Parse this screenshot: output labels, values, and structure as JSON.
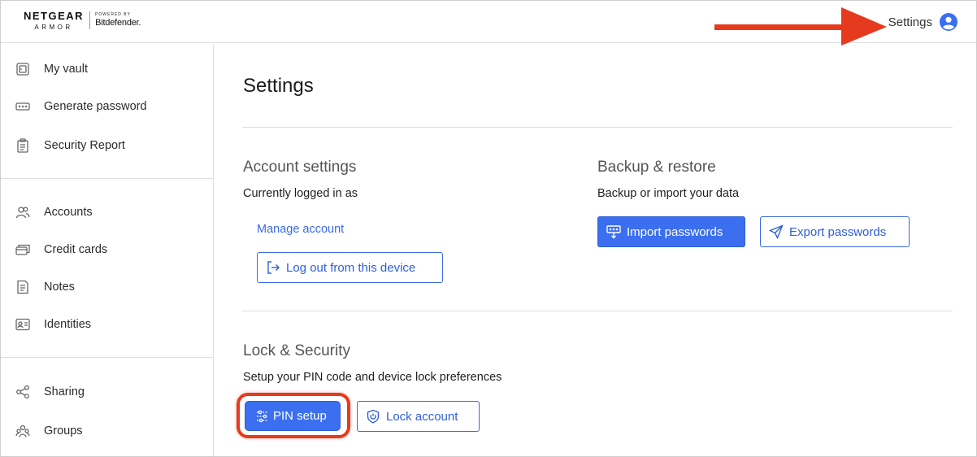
{
  "header": {
    "brand_name": "NETGEAR",
    "brand_sub": "ARMOR",
    "powered_by": "POWERED BY",
    "partner": "Bitdefender.",
    "settings_label": "Settings",
    "avatar_icon": "user-circle-icon",
    "annotation_color": "#e53a1e"
  },
  "sidebar": {
    "items": [
      {
        "label": "My vault",
        "icon": "vault-icon"
      },
      {
        "label": "Generate password",
        "icon": "password-dots-icon"
      },
      {
        "label": "Security Report",
        "icon": "clipboard-icon"
      },
      {
        "label": "Accounts",
        "icon": "users-icon"
      },
      {
        "label": "Credit cards",
        "icon": "credit-card-icon"
      },
      {
        "label": "Notes",
        "icon": "note-icon"
      },
      {
        "label": "Identities",
        "icon": "id-card-icon"
      },
      {
        "label": "Sharing",
        "icon": "share-icon"
      },
      {
        "label": "Groups",
        "icon": "groups-icon"
      }
    ]
  },
  "main": {
    "title": "Settings",
    "account": {
      "title": "Account settings",
      "desc": "Currently logged in as",
      "manage_link": "Manage account",
      "logout_label": "Log out from this device"
    },
    "backup": {
      "title": "Backup & restore",
      "desc": "Backup or import your data",
      "import_label": "Import passwords",
      "export_label": "Export passwords"
    },
    "lock": {
      "title": "Lock & Security",
      "desc": "Setup your PIN code and device lock preferences",
      "pin_label": "PIN setup",
      "lock_label": "Lock account"
    }
  },
  "colors": {
    "accent": "#3b6ff0",
    "link": "#3a68e6",
    "annotation": "#e53a1e"
  }
}
